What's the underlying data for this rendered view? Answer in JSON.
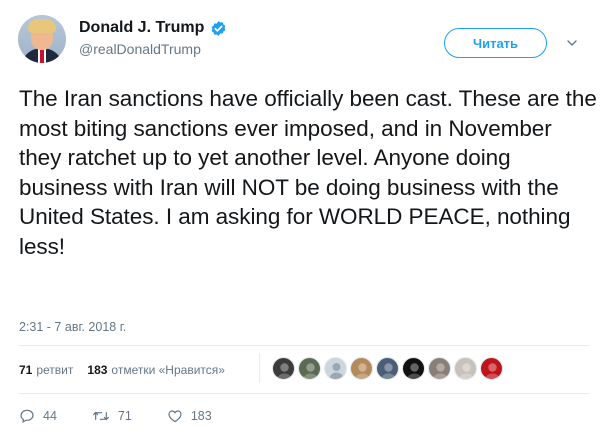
{
  "author": {
    "display_name": "Donald J. Trump",
    "handle": "@realDonaldTrump",
    "verified": true
  },
  "follow_button": {
    "label": "Читать"
  },
  "tweet": {
    "text": "The Iran sanctions have officially been cast. These are the most biting sanctions ever imposed, and in November they ratchet up to yet another level. Anyone doing business with Iran will NOT be doing business with the United States. I am asking for WORLD PEACE, nothing less!",
    "timestamp": "2:31 - 7 авг. 2018 г."
  },
  "stats": {
    "retweets_count": "71",
    "retweets_label": "ретвит",
    "likes_count": "183",
    "likes_label": "отметки «Нравится»"
  },
  "liker_avatars": [
    {
      "icon": "user-avatar",
      "color": "#3b3b3b"
    },
    {
      "icon": "user-avatar",
      "color": "#5b6b52"
    },
    {
      "icon": "default-avatar",
      "color": "#ccd6dd"
    },
    {
      "icon": "user-avatar",
      "color": "#b58a5a"
    },
    {
      "icon": "user-avatar",
      "color": "#4a5e78"
    },
    {
      "icon": "user-avatar",
      "color": "#111111"
    },
    {
      "icon": "user-avatar",
      "color": "#8a7f76"
    },
    {
      "icon": "user-avatar",
      "color": "#c9c2bb"
    },
    {
      "icon": "user-avatar",
      "color": "#c0141a"
    }
  ],
  "actions": {
    "reply_count": "44",
    "retweet_count": "71",
    "like_count": "183"
  },
  "colors": {
    "accent": "#1da1f2",
    "text": "#14171a",
    "secondary": "#657786",
    "divider": "#e6ecf0"
  }
}
